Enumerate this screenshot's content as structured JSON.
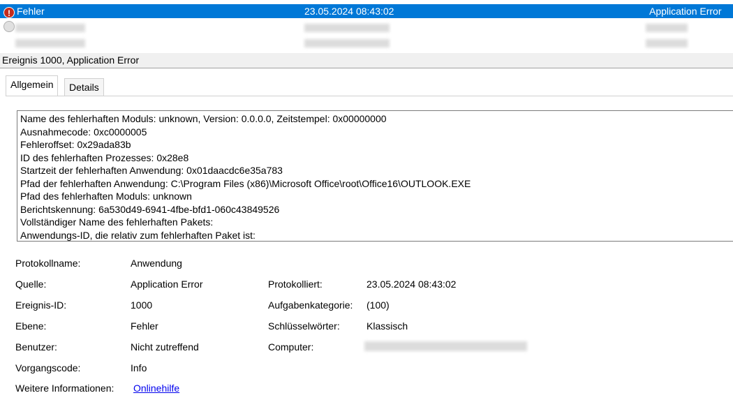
{
  "event_list": {
    "selected": {
      "level": "Fehler",
      "time": "23.05.2024 08:43:02",
      "source": "Application Error"
    }
  },
  "event_title": "Ereignis 1000, Application Error",
  "tabs": [
    {
      "label": "Allgemein",
      "active": true
    },
    {
      "label": "Details",
      "active": false
    }
  ],
  "description_lines": [
    "Name des fehlerhaften Moduls: unknown, Version: 0.0.0.0, Zeitstempel: 0x00000000",
    "Ausnahmecode: 0xc0000005",
    "Fehleroffset: 0x29ada83b",
    "ID des fehlerhaften Prozesses: 0x28e8",
    "Startzeit der fehlerhaften Anwendung: 0x01daacdc6e35a783",
    "Pfad der fehlerhaften Anwendung: C:\\Program Files (x86)\\Microsoft Office\\root\\Office16\\OUTLOOK.EXE",
    "Pfad des fehlerhaften Moduls: unknown",
    "Berichtskennung: 6a530d49-6941-4fbe-bfd1-060c43849526",
    "Vollständiger Name des fehlerhaften Pakets:",
    "Anwendungs-ID, die relativ zum fehlerhaften Paket ist:"
  ],
  "properties": {
    "log_name_label": "Protokollname:",
    "log_name": "Anwendung",
    "source_label": "Quelle:",
    "source": "Application Error",
    "logged_label": "Protokolliert:",
    "logged": "23.05.2024 08:43:02",
    "event_id_label": "Ereignis-ID:",
    "event_id": "1000",
    "task_category_label": "Aufgabenkategorie:",
    "task_category": "(100)",
    "level_label": "Ebene:",
    "level": "Fehler",
    "keywords_label": "Schlüsselwörter:",
    "keywords": "Klassisch",
    "user_label": "Benutzer:",
    "user": "Nicht zutreffend",
    "computer_label": "Computer:",
    "opcode_label": "Vorgangscode:",
    "opcode": "Info",
    "more_info_label": "Weitere Informationen:",
    "more_info_link": "Onlinehilfe"
  },
  "colors": {
    "selection": "#0078d7",
    "error_icon": "#c42b1c",
    "link": "#0000ee"
  },
  "icons": {
    "level_icon": "error-icon"
  }
}
